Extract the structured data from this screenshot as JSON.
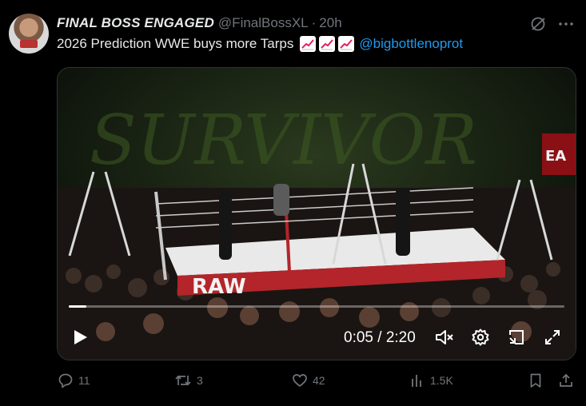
{
  "tweet": {
    "display_name": "FINAL BOSS ENGAGED",
    "handle": "@FinalBossXL",
    "separator": "·",
    "time": "20h",
    "text": "2026 Prediction WWE buys more Tarps",
    "emoji_icons": [
      "chart-increasing-icon",
      "chart-increasing-icon",
      "chart-increasing-icon"
    ],
    "mention": "@bigbottlenoprot"
  },
  "video": {
    "timecode": "0:05 / 2:20",
    "progress": 0.036,
    "muted": true
  },
  "actions": {
    "replies": "11",
    "reposts": "3",
    "likes": "42",
    "views": "1.5K"
  },
  "colors": {
    "accent": "#1d9bf0",
    "muted_text": "#71767b",
    "text": "#e7e9ea",
    "background": "#000000"
  }
}
